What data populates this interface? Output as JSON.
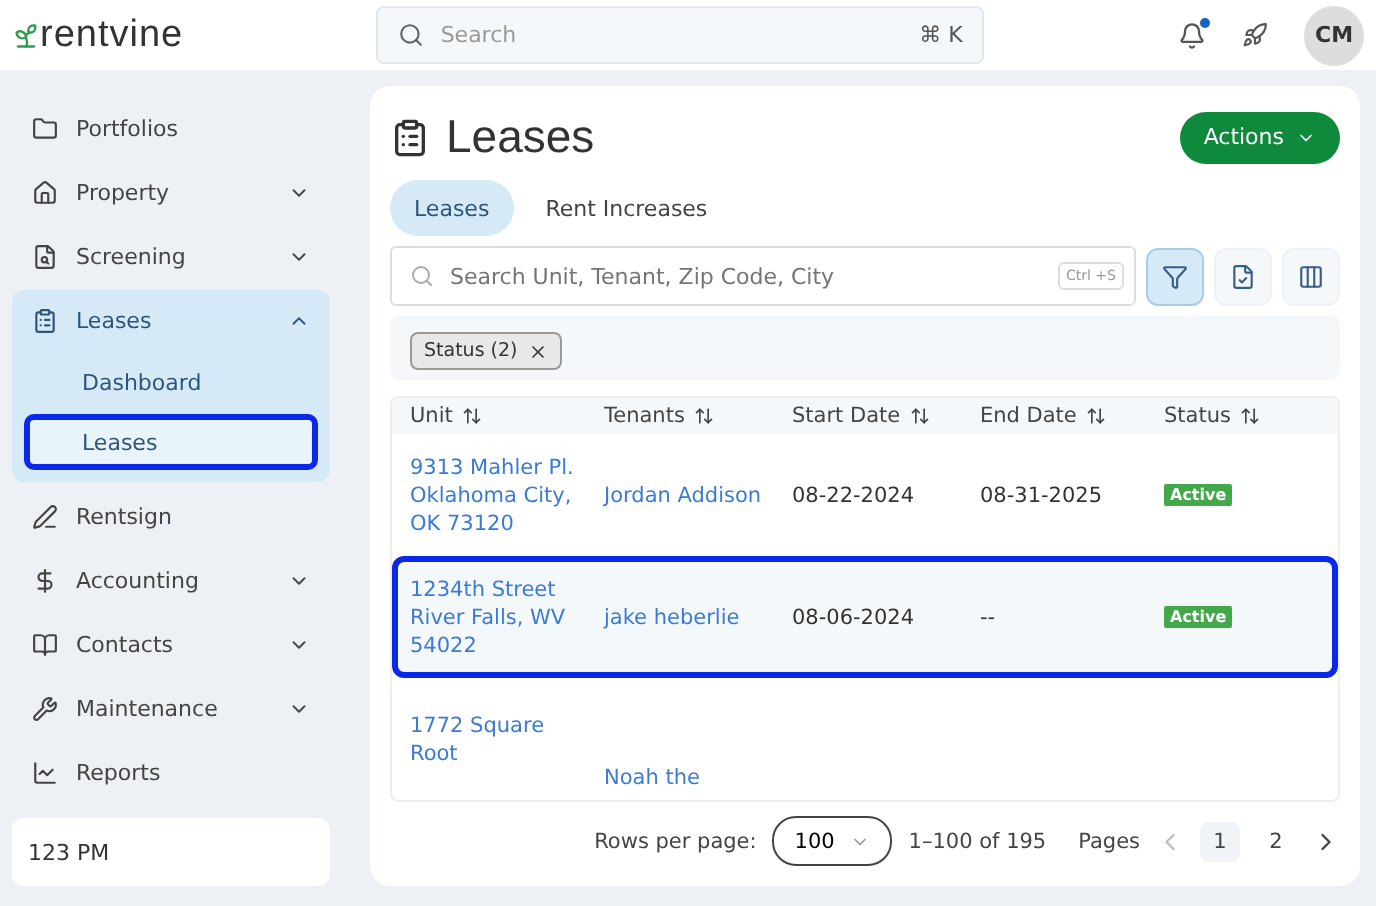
{
  "brand": {
    "name": "rentvine"
  },
  "search": {
    "placeholder": "Search",
    "shortcut": "⌘ K"
  },
  "notifications": {
    "unread": true
  },
  "user": {
    "initials": "CM"
  },
  "sidebar": {
    "items": [
      {
        "label": "Portfolios",
        "expandable": false
      },
      {
        "label": "Property",
        "expandable": true,
        "expanded": false
      },
      {
        "label": "Screening",
        "expandable": true,
        "expanded": false
      },
      {
        "label": "Leases",
        "expandable": true,
        "expanded": true,
        "children": [
          {
            "label": "Dashboard",
            "selected": false
          },
          {
            "label": "Leases",
            "selected": true
          }
        ]
      },
      {
        "label": "Rentsign",
        "expandable": false
      },
      {
        "label": "Accounting",
        "expandable": true,
        "expanded": false
      },
      {
        "label": "Contacts",
        "expandable": true,
        "expanded": false
      },
      {
        "label": "Maintenance",
        "expandable": true,
        "expanded": false
      },
      {
        "label": "Reports",
        "expandable": false
      }
    ],
    "footer": "123 PM"
  },
  "page": {
    "title": "Leases",
    "actions": "Actions"
  },
  "tabs": [
    {
      "label": "Leases",
      "selected": true
    },
    {
      "label": "Rent Increases",
      "selected": false
    }
  ],
  "filter_search": {
    "placeholder": "Search Unit, Tenant, Zip Code, City",
    "shortcut": "Ctrl +S"
  },
  "filter_active": true,
  "chips": [
    {
      "label": "Status (2)"
    }
  ],
  "table": {
    "columns": [
      "Unit",
      "Tenants",
      "Start Date",
      "End Date",
      "Status"
    ],
    "rows": [
      {
        "unit": [
          "9313 Mahler Pl.",
          "Oklahoma City,",
          "OK 73120"
        ],
        "tenant": "Jordan Addison",
        "start": "08-22-2024",
        "end": "08-31-2025",
        "status": "Active",
        "selected": false
      },
      {
        "unit": [
          "1234th Street",
          "River Falls, WV",
          "54022"
        ],
        "tenant": "jake heberlie",
        "start": "08-06-2024",
        "end": "--",
        "status": "Active",
        "selected": true
      },
      {
        "unit": [
          "1772 Square",
          "Root"
        ],
        "tenant": "Noah the",
        "selected": false
      }
    ]
  },
  "pagination": {
    "rows_label": "Rows per page:",
    "rows_value": "100",
    "range": "1–100 of 195",
    "pages_label": "Pages",
    "pages": [
      {
        "label": "1",
        "selected": true
      },
      {
        "label": "2",
        "selected": false
      }
    ]
  }
}
